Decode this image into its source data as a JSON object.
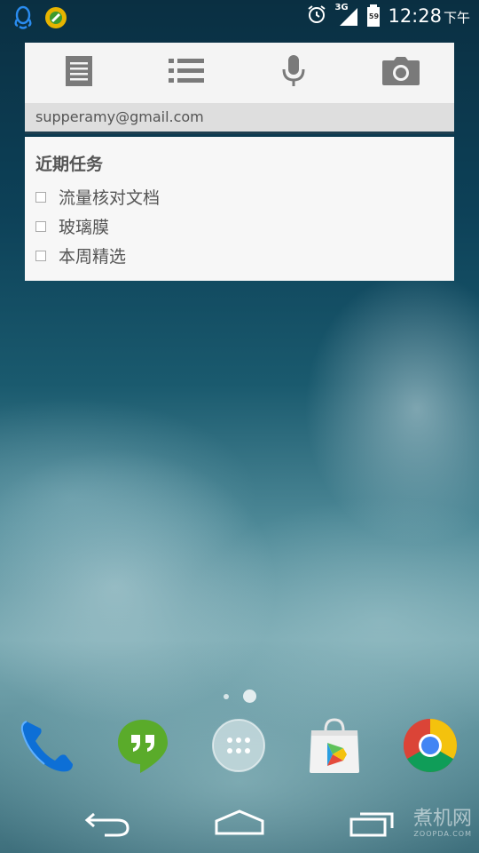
{
  "status_bar": {
    "time": "12:28",
    "time_suffix": "下午",
    "network_type": "3G",
    "battery_level": "59",
    "icons": [
      "qq-icon",
      "app-notification-icon",
      "alarm-icon",
      "signal-icon",
      "battery-icon"
    ]
  },
  "keep_widget": {
    "toolbar": [
      "new-text-note-icon",
      "new-list-note-icon",
      "voice-note-icon",
      "photo-note-icon"
    ],
    "account": "supperamy@gmail.com",
    "note": {
      "title": "近期任务",
      "items": [
        {
          "text": "流量核对文档",
          "checked": false
        },
        {
          "text": "玻璃膜",
          "checked": false
        },
        {
          "text": "本周精选",
          "checked": false
        }
      ]
    }
  },
  "page_indicator": {
    "pages": 2,
    "current": 2
  },
  "dock": [
    "phone-icon",
    "hangouts-icon",
    "app-drawer-icon",
    "play-store-icon",
    "chrome-icon"
  ],
  "nav_bar": [
    "back-icon",
    "home-icon",
    "recents-icon"
  ],
  "watermark": {
    "main": "煮机网",
    "sub": "ZOOPDA.COM"
  },
  "colors": {
    "widget_bg": "#f4f4f4",
    "account_bg": "#dedede",
    "icon_gray": "#7a7a7a",
    "text_gray": "#555555",
    "hangouts_green": "#5aab2a",
    "phone_blue": "#0d6fd6"
  }
}
